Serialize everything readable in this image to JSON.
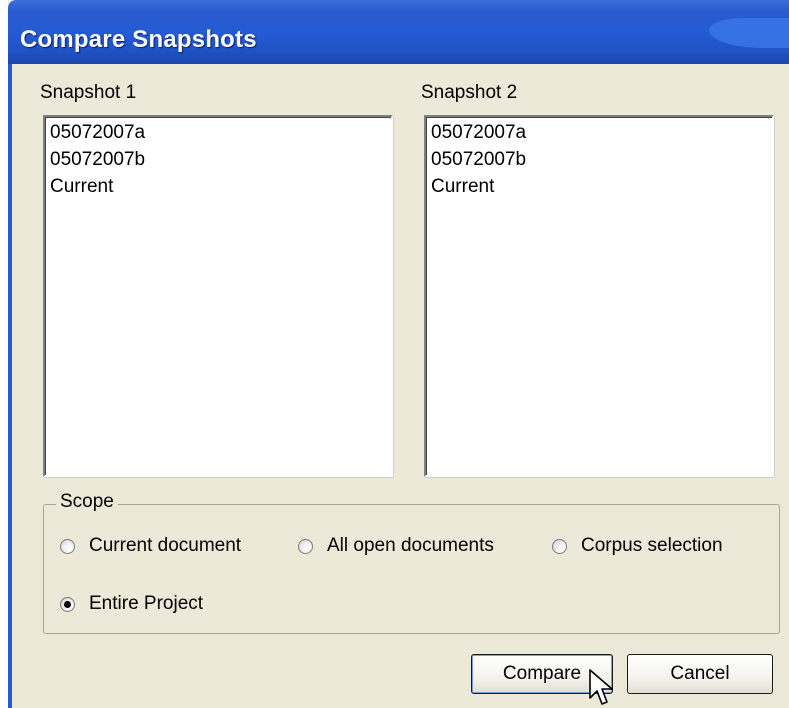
{
  "window": {
    "title": "Compare Snapshots"
  },
  "snapshot1": {
    "label": "Snapshot 1",
    "items": [
      "05072007a",
      "05072007b",
      "Current"
    ]
  },
  "snapshot2": {
    "label": "Snapshot 2",
    "items": [
      "05072007a",
      "05072007b",
      "Current"
    ]
  },
  "scope": {
    "label": "Scope",
    "options": [
      {
        "label": "Current document",
        "checked": false
      },
      {
        "label": "All open documents",
        "checked": false
      },
      {
        "label": "Corpus selection",
        "checked": false
      },
      {
        "label": "Entire Project",
        "checked": true
      }
    ]
  },
  "buttons": {
    "compare_label": "Compare",
    "cancel_label": "Cancel"
  },
  "icons": {
    "cursor": "arrow-cursor-icon"
  }
}
